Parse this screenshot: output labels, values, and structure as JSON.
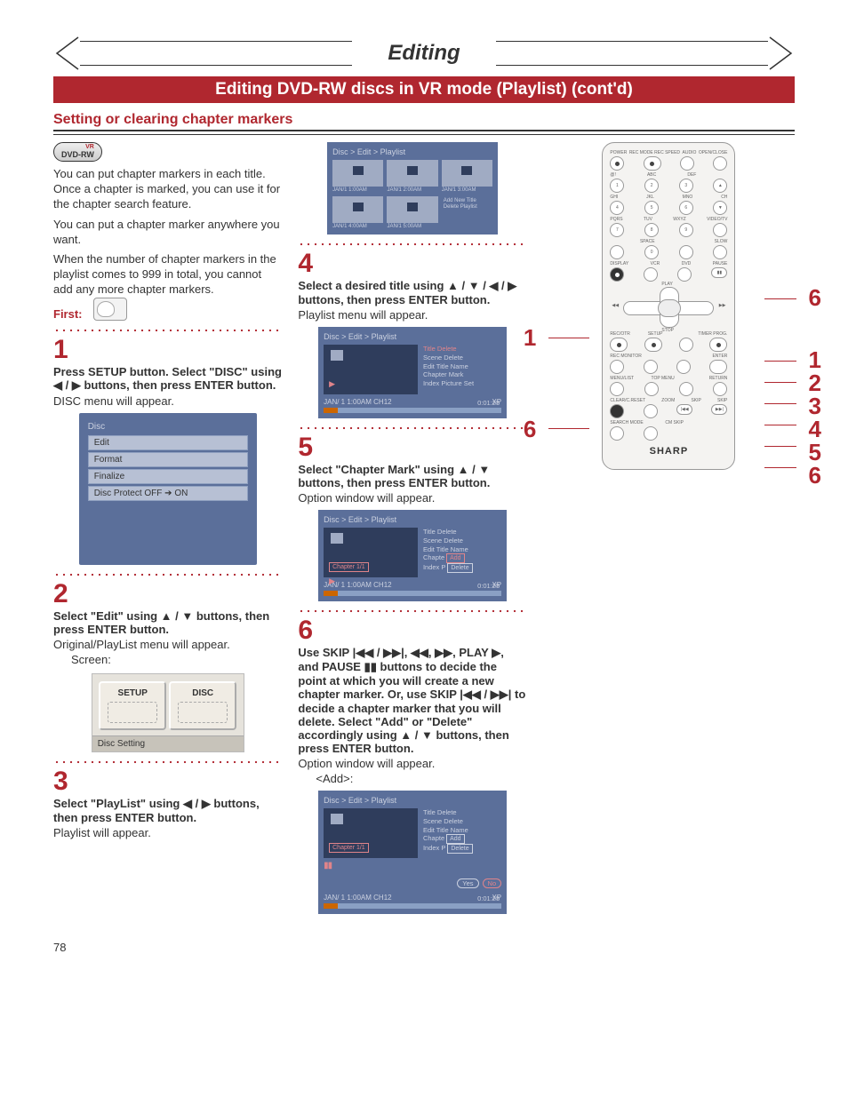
{
  "title": "Editing",
  "redbar": "Editing DVD-RW discs in VR mode (Playlist) (cont'd)",
  "subheading": "Setting or clearing chapter markers",
  "badge": {
    "vr": "VR",
    "text": "DVD-RW"
  },
  "intro": [
    "You can put chapter markers in each title. Once a chapter is marked, you can use it for the chapter search feature.",
    "You can put a chapter marker anywhere you want.",
    "When the number of chapter markers in the playlist comes to 999 in total, you cannot add any more chapter markers."
  ],
  "first_label": "First:",
  "steps": {
    "s1": {
      "num": "1",
      "bold": "Press SETUP button. Select \"DISC\" using ◀ / ▶ buttons, then press ENTER button.",
      "plain": "DISC menu will appear."
    },
    "s2": {
      "num": "2",
      "bold": "Select \"Edit\" using ▲ / ▼ buttons, then press ENTER button.",
      "plain": "Original/PlayList menu will appear.",
      "screen_label": "Screen:"
    },
    "s3": {
      "num": "3",
      "bold": "Select \"PlayList\" using ◀ / ▶ buttons, then press ENTER button.",
      "plain": "Playlist will appear."
    },
    "s4": {
      "num": "4",
      "bold": "Select a desired title using ▲ / ▼ / ◀ / ▶ buttons, then press ENTER button.",
      "plain": "Playlist menu will appear."
    },
    "s5": {
      "num": "5",
      "bold": "Select \"Chapter Mark\" using ▲ / ▼ buttons, then press ENTER button.",
      "plain": "Option window will appear."
    },
    "s6": {
      "num": "6",
      "bold": "Use SKIP |◀◀ / ▶▶|, ◀◀, ▶▶, PLAY ▶, and PAUSE ▮▮ buttons to decide the point at which you will create a new chapter marker. Or, use SKIP |◀◀ / ▶▶| to decide a chapter marker that you will delete. Select \"Add\" or \"Delete\" accordingly using ▲ / ▼ buttons, then press ENTER button.",
      "plain": "Option window will appear.",
      "add_label": "<Add>:"
    }
  },
  "disc_menu": {
    "header": "Disc",
    "rows": [
      "Edit",
      "Format",
      "Finalize",
      "Disc Protect OFF ➔ ON"
    ]
  },
  "setup_shot": {
    "btn1": "SETUP",
    "btn2": "DISC",
    "bar": "Disc Setting"
  },
  "playlist_grid": {
    "crumb": "Disc > Edit > Playlist",
    "labels": [
      "JAN/1  1:00AM",
      "JAN/1  2:00AM",
      "JAN/1  3:00AM",
      "JAN/1  4:00AM",
      "JAN/1  5:00AM"
    ],
    "addnew": "Add New\nTitle\nDelete\nPlaylist"
  },
  "panel_common": {
    "crumb": "Disc > Edit > Playlist",
    "bottom_left": "JAN/ 1   1:00AM  CH12",
    "bottom_right": "XP",
    "time": "0:01:25",
    "chapter": "Chapter 1/1"
  },
  "panel_s4_menu": [
    "Title Delete",
    "Scene Delete",
    "Edit Title Name",
    "Chapter Mark",
    "Index Picture Set"
  ],
  "panel_s5_menu_prefix": [
    "Title Delete",
    "Scene Delete",
    "Edit Title Name"
  ],
  "panel_s5_chapter_row": "Chapte",
  "panel_s5_index_row": "Index P",
  "panel_pop": {
    "add": "Add",
    "delete": "Delete"
  },
  "panel_s6_yesno": {
    "yes": "Yes",
    "no": "No"
  },
  "remote": {
    "brand": "SHARP",
    "rows_labels": [
      [
        "POWER",
        "REC MODE REC SPEED",
        "AUDIO",
        "OPEN/CLOSE"
      ],
      [
        "@!",
        "ABC",
        "DEF",
        ""
      ],
      [
        "GHI",
        "JKL",
        "MNO",
        "CH"
      ],
      [
        "PQRS",
        "TUV",
        "WXYZ",
        "VIDEO/TV"
      ],
      [
        "",
        "SPACE",
        "",
        "SLOW"
      ],
      [
        "DISPLAY",
        "VCR",
        "DVD",
        "PAUSE"
      ],
      [
        "",
        "PLAY",
        "",
        ""
      ],
      [
        "",
        "STOP",
        "",
        ""
      ],
      [
        "REC/OTR",
        "SETUP",
        "",
        "TIMER PROG."
      ],
      [
        "REC MONITOR",
        "",
        "",
        "ENTER"
      ],
      [
        "MENU/LIST",
        "TOP MENU",
        "",
        "RETURN"
      ],
      [
        "CLEAR/C.RESET",
        "ZOOM",
        "SKIP",
        "SKIP"
      ],
      [
        "SEARCH MODE",
        "CM SKIP",
        "",
        ""
      ]
    ]
  },
  "callouts": {
    "left1": "1",
    "left6": "6",
    "right6": "6",
    "right_stack": [
      "1",
      "2",
      "3",
      "4",
      "5",
      "6"
    ]
  },
  "page_number": "78"
}
